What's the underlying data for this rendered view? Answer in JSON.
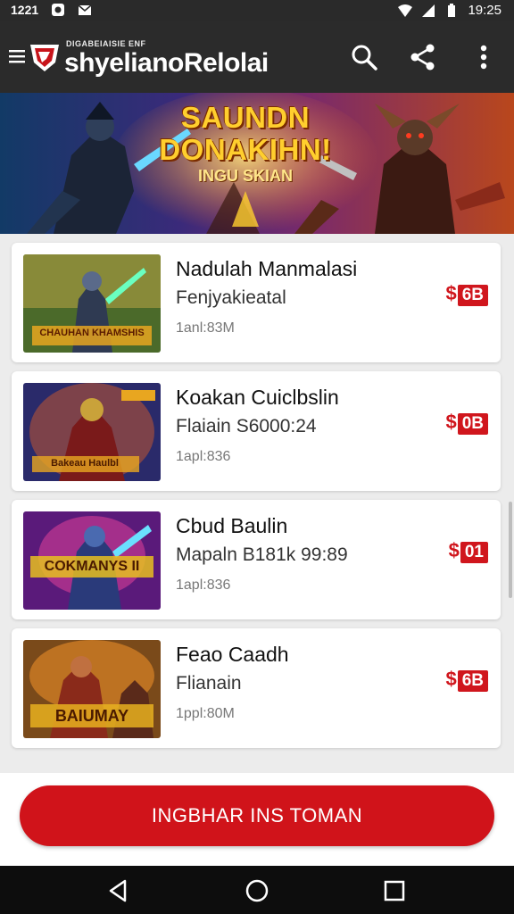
{
  "status": {
    "left_time": "1221",
    "right_time": "19:25",
    "icons": [
      "media-icon",
      "mail-icon",
      "wifi-icon",
      "signal-icon",
      "battery-icon"
    ]
  },
  "appbar": {
    "brand_small": "DIGABEIAISIE ENF",
    "brand": "shyelianoRelolai",
    "icons": [
      "menu-icon",
      "logo-icon",
      "search-icon",
      "share-icon",
      "more-vert-icon"
    ]
  },
  "banner": {
    "title_line1": "SAUNDN",
    "title_line2": "DONAKIHN!",
    "title_line3": "INGU SKIAN"
  },
  "items": [
    {
      "title": "Nadulah Manmalasi",
      "subtitle": "Fenjyakieatal",
      "meta": "1anl:83M",
      "price_symbol": "$",
      "price_box": "6B",
      "thumb_text": "CHAUHAN KHAMSHIS"
    },
    {
      "title": "Koakan Cuiclbslin",
      "subtitle": "Flaiain S6000:24",
      "meta": "1apl:836",
      "price_symbol": "$",
      "price_box": "0B",
      "thumb_text": "Bakeau Haulbl"
    },
    {
      "title": "Cbud Baulin",
      "subtitle": "Mapaln B181k 99:89",
      "meta": "1apl:836",
      "price_symbol": "$",
      "price_box": "01",
      "thumb_text": "COKMANYS II"
    },
    {
      "title": "Feao Caadh",
      "subtitle": "Flianain",
      "meta": "1ppl:80M",
      "price_symbol": "$",
      "price_box": "6B",
      "thumb_text": "BAIUMAY"
    }
  ],
  "cta": {
    "label": "INGBHAR INS TOMAN"
  },
  "colors": {
    "accent": "#d0131a",
    "appbar": "#2b2b2b",
    "price": "#d0161d"
  }
}
